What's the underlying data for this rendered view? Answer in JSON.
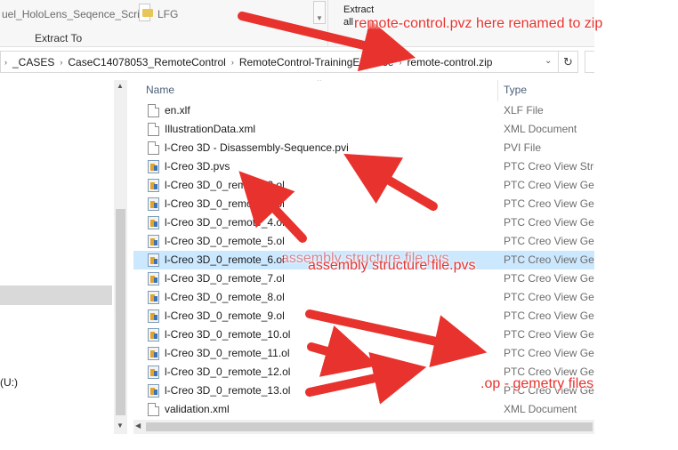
{
  "ribbon": {
    "recent_item_1": "uel_HoloLens_Seqence_Script",
    "recent_item_2": "LFG",
    "extract_button_label": "Extract\nall",
    "group_label": "Extract To"
  },
  "address": {
    "crumbs": [
      "_CASES",
      "CaseC14078053_RemoteControl",
      "RemoteControl-TrainingExercise",
      "remote-control.zip"
    ]
  },
  "nav": {
    "drive_label": "(U:)"
  },
  "columns": {
    "name": "Name",
    "type": "Type"
  },
  "files": [
    {
      "name": "en.xlf",
      "type": "XLF File",
      "icon": "document-icon"
    },
    {
      "name": "IllustrationData.xml",
      "type": "XML Document",
      "icon": "document-icon"
    },
    {
      "name": "l-Creo 3D - Disassembly-Sequence.pvi",
      "type": "PVI File",
      "icon": "document-icon"
    },
    {
      "name": "l-Creo 3D.pvs",
      "type": "PTC Creo View Stru",
      "icon": "ptc-creo-icon"
    },
    {
      "name": "l-Creo 3D_0_remote_2.ol",
      "type": "PTC Creo View Geo",
      "icon": "ptc-creo-icon"
    },
    {
      "name": "l-Creo 3D_0_remote_3.ol",
      "type": "PTC Creo View Geo",
      "icon": "ptc-creo-icon"
    },
    {
      "name": "l-Creo 3D_0_remote_4.ol",
      "type": "PTC Creo View Geo",
      "icon": "ptc-creo-icon"
    },
    {
      "name": "l-Creo 3D_0_remote_5.ol",
      "type": "PTC Creo View Geo",
      "icon": "ptc-creo-icon"
    },
    {
      "name": "l-Creo 3D_0_remote_6.ol",
      "type": "PTC Creo View Geo",
      "icon": "ptc-creo-icon",
      "selected": true
    },
    {
      "name": "l-Creo 3D_0_remote_7.ol",
      "type": "PTC Creo View Geo",
      "icon": "ptc-creo-icon"
    },
    {
      "name": "l-Creo 3D_0_remote_8.ol",
      "type": "PTC Creo View Geo",
      "icon": "ptc-creo-icon"
    },
    {
      "name": "l-Creo 3D_0_remote_9.ol",
      "type": "PTC Creo View Geo",
      "icon": "ptc-creo-icon"
    },
    {
      "name": "l-Creo 3D_0_remote_10.ol",
      "type": "PTC Creo View Geo",
      "icon": "ptc-creo-icon"
    },
    {
      "name": "l-Creo 3D_0_remote_11.ol",
      "type": "PTC Creo View Geo",
      "icon": "ptc-creo-icon"
    },
    {
      "name": "l-Creo 3D_0_remote_12.ol",
      "type": "PTC Creo View Geo",
      "icon": "ptc-creo-icon"
    },
    {
      "name": "l-Creo 3D_0_remote_13.ol",
      "type": "PTC Creo View Geo",
      "icon": "ptc-creo-icon"
    },
    {
      "name": "validation.xml",
      "type": "XML Document",
      "icon": "document-icon"
    }
  ],
  "annotations": {
    "zip_note": "remote-control.pvz here renamed to zip",
    "pvs_note": "assembly structure file.pvs",
    "ol_note": ".op - gemetry files"
  },
  "colors": {
    "annotation": "#e8322d",
    "selection": "#cce8ff"
  }
}
